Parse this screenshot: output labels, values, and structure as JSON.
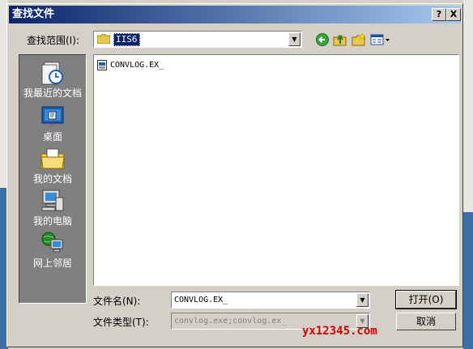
{
  "window": {
    "title": "查找文件",
    "help_button": "?",
    "close_button": "X"
  },
  "lookin": {
    "label": "查找范围(I):",
    "value": "IIS6"
  },
  "places": [
    {
      "label": "我最近的文档",
      "icon": "recent-documents-icon"
    },
    {
      "label": "桌面",
      "icon": "desktop-icon"
    },
    {
      "label": "我的文档",
      "icon": "my-documents-icon"
    },
    {
      "label": "我的电脑",
      "icon": "my-computer-icon"
    },
    {
      "label": "网上邻居",
      "icon": "network-places-icon"
    }
  ],
  "files": [
    {
      "name": "CONVLOG.EX_",
      "icon": "compressed-file-icon"
    }
  ],
  "filename": {
    "label": "文件名(N):",
    "value": "CONVLOG.EX_"
  },
  "filetype": {
    "label": "文件类型(T):",
    "value": "convlog.exe;convlog.ex_"
  },
  "buttons": {
    "open": "打开(O)",
    "cancel": "取消"
  },
  "watermark": "yx12345.com",
  "colors": {
    "title_start": "#0a246a",
    "title_end": "#a6caf0",
    "places_bg": "#808080",
    "dialog_bg": "#d4d0c8",
    "watermark": "#d40000"
  }
}
